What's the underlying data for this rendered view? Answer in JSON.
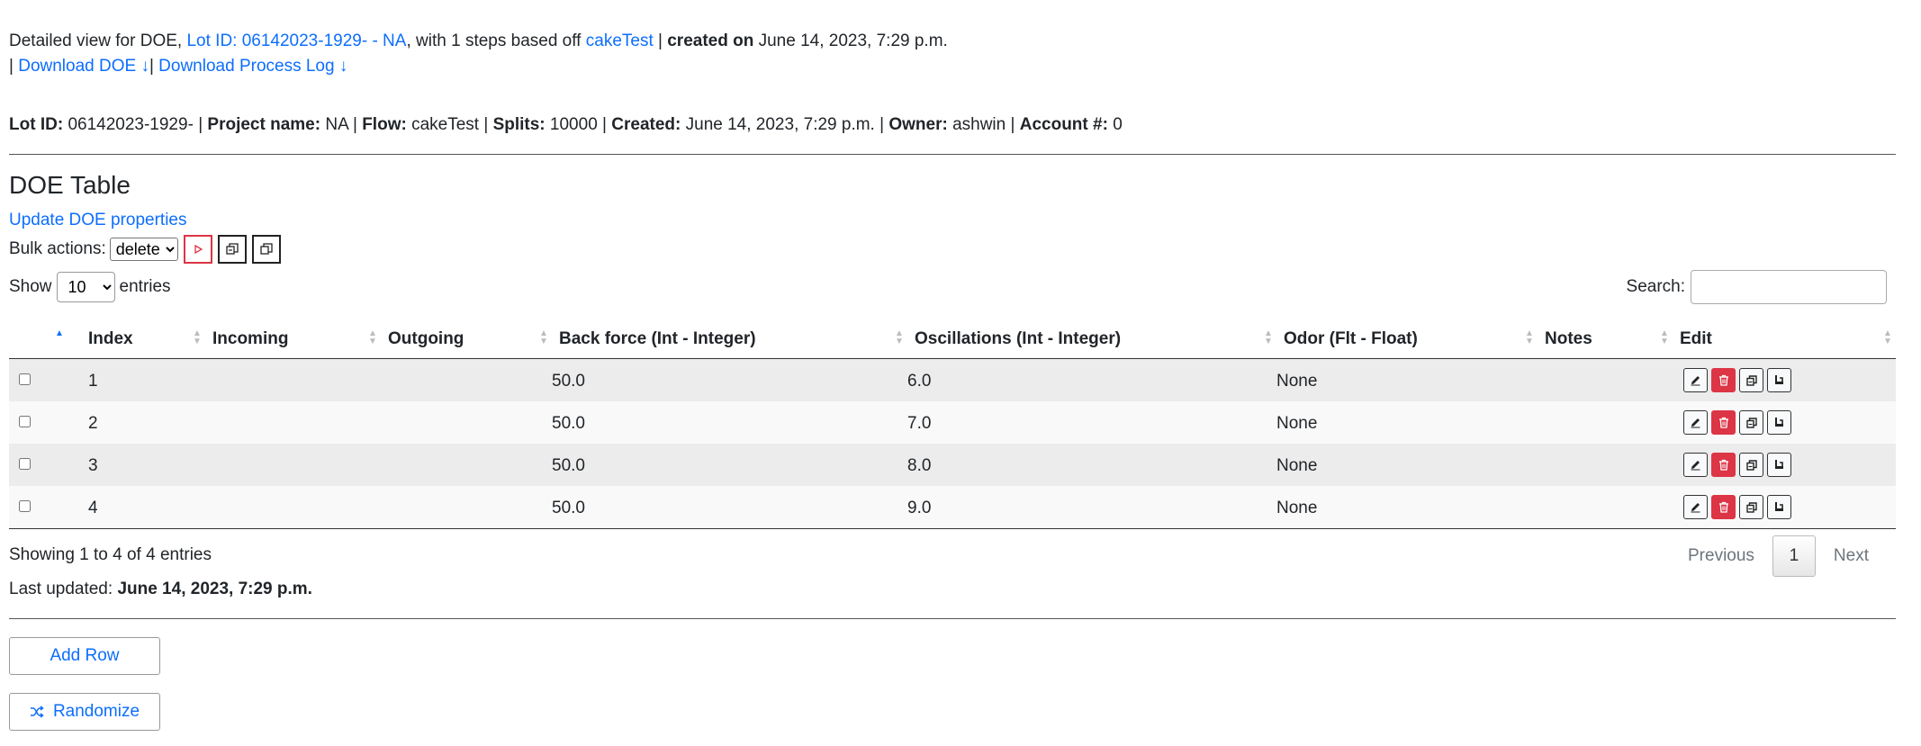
{
  "header": {
    "prefix": "Detailed view for DOE,",
    "lot_link": "Lot ID: 06142023-1929- - NA",
    "steps_text": ", with 1 steps based off",
    "flow_link": "cakeTest",
    "sep": "|",
    "created_label": "created on",
    "created_value": "June 14, 2023, 7:29 p.m.",
    "download_sep_start": "|",
    "download_doe": "Download DOE ↓",
    "download_sep_mid": "|",
    "download_log": "Download Process Log ↓"
  },
  "info": {
    "lot_label": "Lot ID:",
    "lot_value": "06142023-1929-",
    "project_label": "Project name:",
    "project_value": "NA",
    "flow_label": "Flow:",
    "flow_value": "cakeTest",
    "splits_label": "Splits:",
    "splits_value": "10000",
    "created_label": "Created:",
    "created_value": "June 14, 2023, 7:29 p.m.",
    "owner_label": "Owner:",
    "owner_value": "ashwin",
    "account_label": "Account #:",
    "account_value": "0",
    "sep": "|"
  },
  "doe": {
    "title": "DOE Table",
    "update_link": "Update DOE properties",
    "bulk_label": "Bulk actions:",
    "bulk_selected": "delete",
    "show_label": "Show",
    "show_value": "10",
    "entries_label": "entries",
    "search_label": "Search:",
    "search_value": ""
  },
  "table": {
    "columns": [
      "Index",
      "Incoming",
      "Outgoing",
      "Back force (Int - Integer)",
      "Oscillations (Int - Integer)",
      "Odor (Flt - Float)",
      "Notes",
      "Edit"
    ],
    "rows": [
      {
        "index": "1",
        "incoming": "",
        "outgoing": "",
        "back_force": "50.0",
        "oscillations": "6.0",
        "odor": "None",
        "notes": ""
      },
      {
        "index": "2",
        "incoming": "",
        "outgoing": "",
        "back_force": "50.0",
        "oscillations": "7.0",
        "odor": "None",
        "notes": ""
      },
      {
        "index": "3",
        "incoming": "",
        "outgoing": "",
        "back_force": "50.0",
        "oscillations": "8.0",
        "odor": "None",
        "notes": ""
      },
      {
        "index": "4",
        "incoming": "",
        "outgoing": "",
        "back_force": "50.0",
        "oscillations": "9.0",
        "odor": "None",
        "notes": ""
      }
    ]
  },
  "footer": {
    "summary": "Showing 1 to 4 of 4 entries",
    "prev": "Previous",
    "page": "1",
    "next": "Next",
    "updated_label": "Last updated:",
    "updated_value": "June 14, 2023, 7:29 p.m.",
    "add_row": "Add Row",
    "randomize": "Randomize"
  },
  "icons": {
    "edit": "pencil-icon",
    "delete": "trash-icon",
    "copy": "copy-icon",
    "split": "split-icon",
    "run": "play-icon",
    "shuffle": "shuffle-icon"
  },
  "colors": {
    "link": "#0d6efd",
    "danger": "#dc3545"
  }
}
